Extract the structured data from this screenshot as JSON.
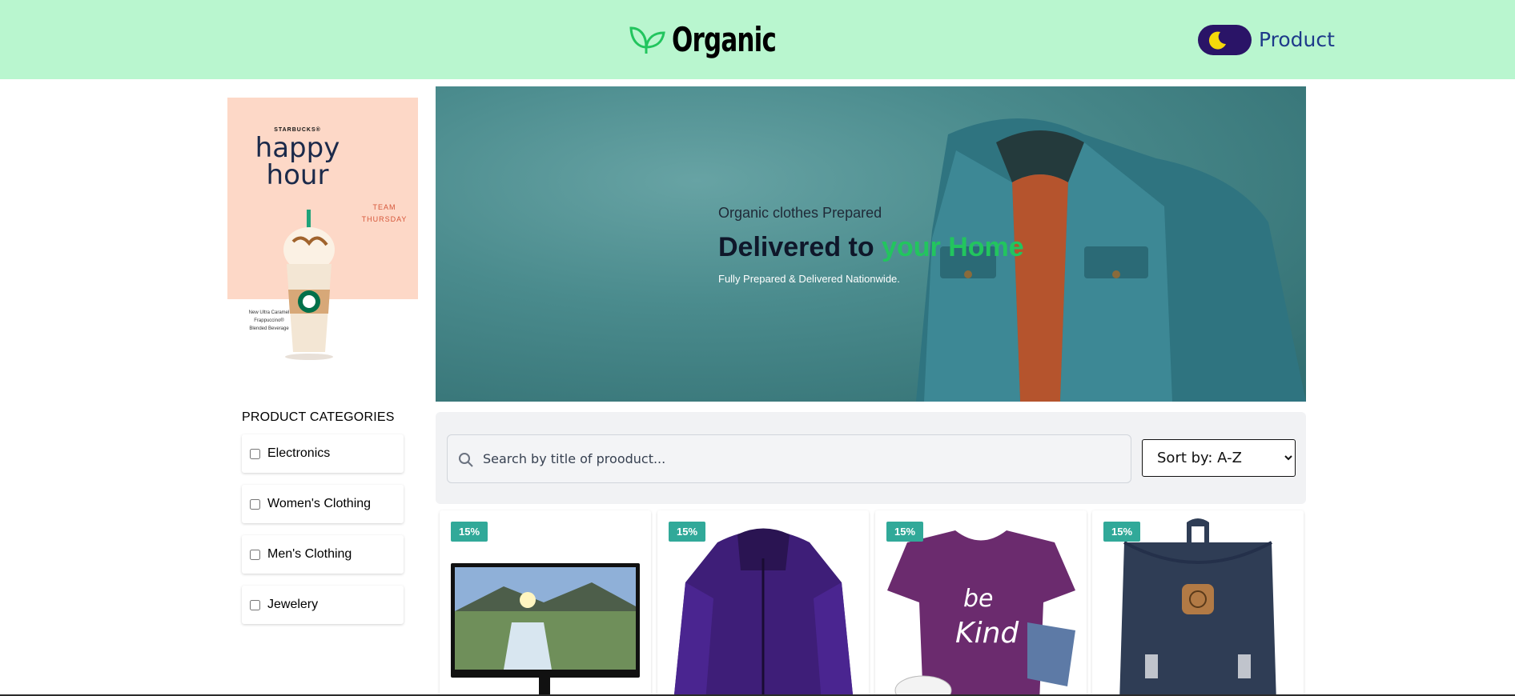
{
  "header": {
    "logo_text": "Organic",
    "nav_product": "Product"
  },
  "ad": {
    "brand": "STARBUCKS®",
    "title_line1": "happy",
    "title_line2": "hour",
    "team_line1": "TEAM",
    "team_line2": "THURSDAY",
    "desc_line1": "New Ultra Caramel",
    "desc_line2": "Frappuccino®",
    "desc_line3": "Blended Beverage"
  },
  "categories": {
    "heading": "PRODUCT CATEGORIES",
    "items": [
      {
        "label": "Electronics"
      },
      {
        "label": "Women's Clothing"
      },
      {
        "label": "Men's Clothing"
      },
      {
        "label": "Jewelery"
      }
    ]
  },
  "hero": {
    "subtitle": "Organic clothes Prepared",
    "title_part1": "Delivered to ",
    "title_highlight": "your Home",
    "tagline": "Fully Prepared & Delivered Nationwide."
  },
  "search": {
    "placeholder": "Search by title of prooduct...",
    "sort_selected": "Sort by: A-Z"
  },
  "products": [
    {
      "discount": "15%",
      "image": "monitor"
    },
    {
      "discount": "15%",
      "image": "purple-jacket"
    },
    {
      "discount": "15%",
      "image": "be-kind-tshirt"
    },
    {
      "discount": "15%",
      "image": "backpack"
    }
  ],
  "colors": {
    "header_bg": "#b9f6cf",
    "accent_green": "#22c55e",
    "badge": "#31a999",
    "toggle": "#2a1467",
    "nav_link": "#1e3a8a"
  }
}
